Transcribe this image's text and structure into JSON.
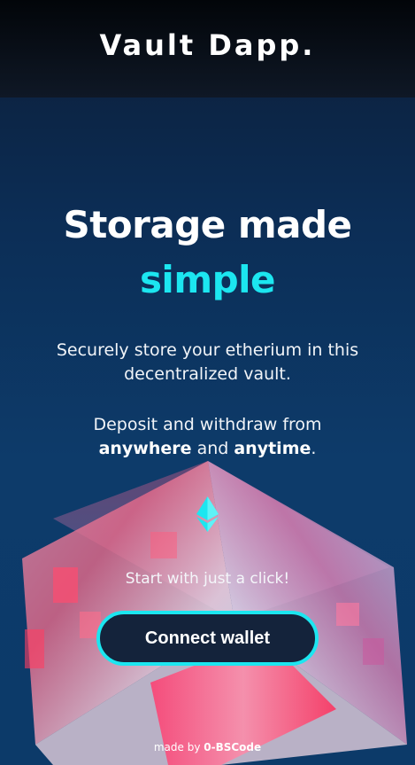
{
  "app": {
    "logo": "Vault Dapp."
  },
  "hero": {
    "headline": "Storage made",
    "headline_accent": "simple",
    "description": "Securely store your etherium in this decentralized vault.",
    "deposit_prefix": "Deposit and withdraw from",
    "deposit_highlight_1": "anywhere",
    "deposit_joiner": " and ",
    "deposit_highlight_2": "anytime",
    "deposit_suffix": ".",
    "icon": "ethereum-icon"
  },
  "cta": {
    "prompt": "Start with just a click!",
    "button_label": "Connect wallet"
  },
  "footer": {
    "prefix": "made by ",
    "author": "0-BSCode"
  },
  "colors": {
    "accent": "#1ce6f0",
    "background": "#0c3a69",
    "header": "#0f1826",
    "button_bg": "#14233b"
  }
}
